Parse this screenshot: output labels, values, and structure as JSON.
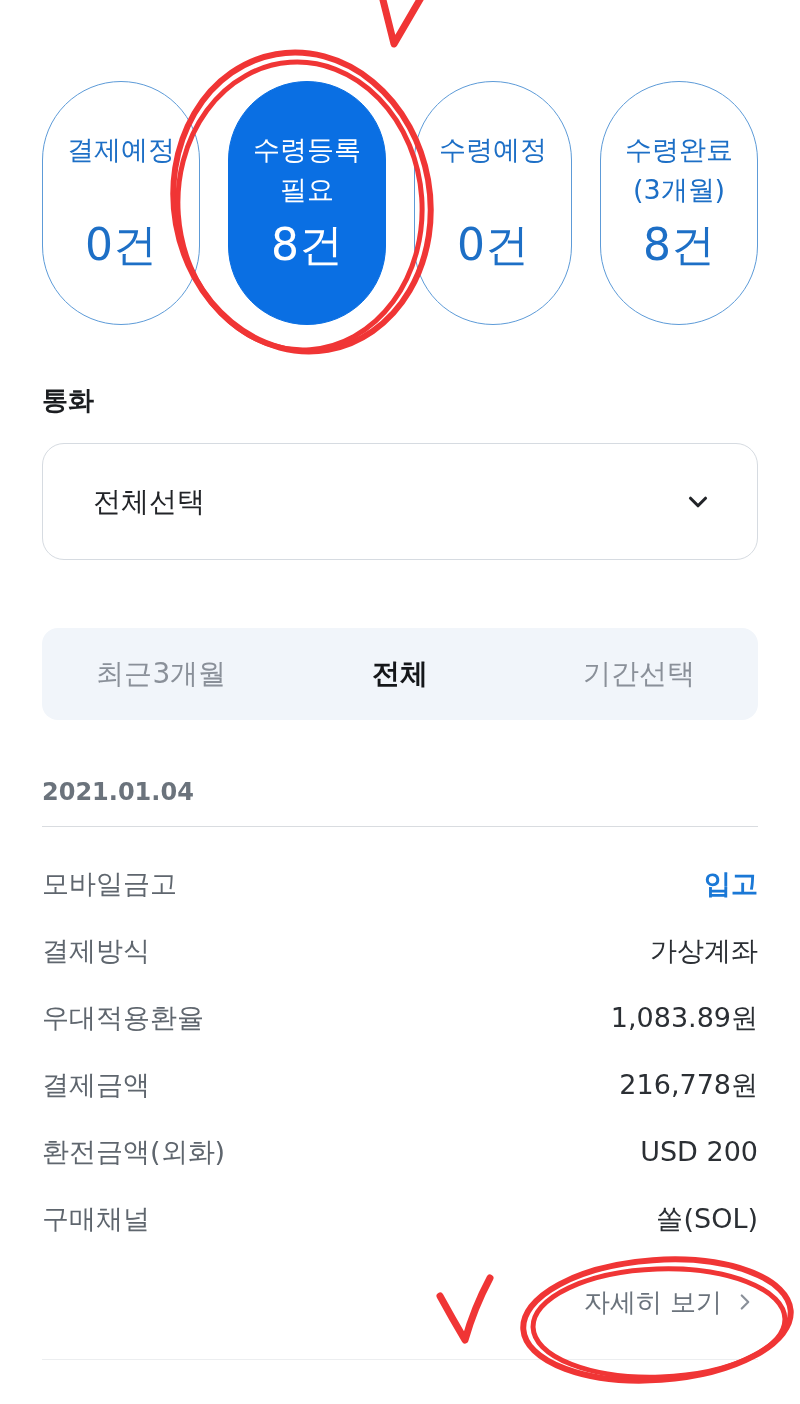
{
  "status_tabs": [
    {
      "label": "결제예정",
      "count": "0건",
      "selected": false
    },
    {
      "label": "수령등록 필요",
      "count": "8건",
      "selected": true
    },
    {
      "label": "수령예정",
      "count": "0건",
      "selected": false
    },
    {
      "label": "수령완료 (3개월)",
      "count": "8건",
      "selected": false
    }
  ],
  "currency": {
    "label": "통화",
    "value": "전체선택"
  },
  "period_tabs": [
    {
      "label": "최근3개월",
      "selected": false
    },
    {
      "label": "전체",
      "selected": true
    },
    {
      "label": "기간선택",
      "selected": false
    }
  ],
  "transaction": {
    "date": "2021.01.04",
    "rows": [
      {
        "label": "모바일금고",
        "value": "입고",
        "highlight": true
      },
      {
        "label": "결제방식",
        "value": "가상계좌",
        "highlight": false
      },
      {
        "label": "우대적용환율",
        "value": "1,083.89원",
        "highlight": false
      },
      {
        "label": "결제금액",
        "value": "216,778원",
        "highlight": false
      },
      {
        "label": "환전금액(외화)",
        "value": "USD 200",
        "highlight": false
      },
      {
        "label": "구매채널",
        "value": "쏠(SOL)",
        "highlight": false
      }
    ],
    "details_link": "자세히 보기"
  }
}
